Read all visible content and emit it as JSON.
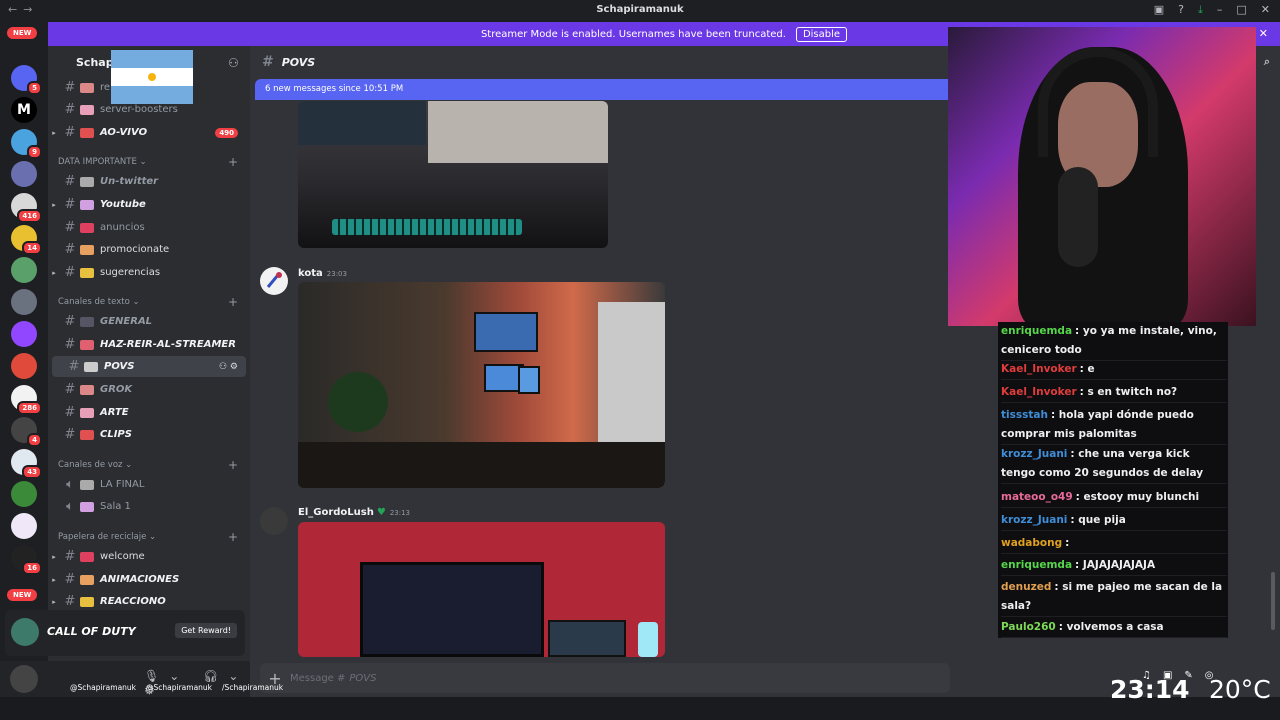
{
  "window": {
    "title": "Schapiramanuk"
  },
  "banner": {
    "text": "Streamer Mode is enabled. Usernames have been truncated.",
    "button": "Disable"
  },
  "servers": {
    "new_label": "NEW",
    "badges": [
      "5",
      "9",
      "416",
      "14",
      "286",
      "4",
      "43",
      "16"
    ]
  },
  "guild": {
    "name": "Schapi"
  },
  "channels": {
    "top": [
      {
        "name": "re",
        "style": "muted"
      },
      {
        "name": "server-boosters",
        "style": "muted"
      },
      {
        "name": "AO-VIVO",
        "style": "bold",
        "count": "490"
      }
    ],
    "cat1": "DATA IMPORTANTE",
    "group1": [
      {
        "name": "Un-twitter",
        "style": "bold-muted"
      },
      {
        "name": "Youtube",
        "style": "bold"
      },
      {
        "name": "anuncios",
        "style": "muted"
      },
      {
        "name": "promocionate",
        "style": "normal"
      },
      {
        "name": "sugerencias",
        "style": "normal"
      }
    ],
    "cat2": "Canales de texto",
    "group2": [
      {
        "name": "GENERAL",
        "style": "bold-muted"
      },
      {
        "name": "HAZ-REIR-AL-STREAMER",
        "style": "bold"
      },
      {
        "name": "POVS",
        "style": "bold"
      },
      {
        "name": "GROK",
        "style": "bold-muted"
      },
      {
        "name": "ARTE",
        "style": "bold"
      },
      {
        "name": "CLIPS",
        "style": "bold"
      }
    ],
    "cat3": "Canales de voz",
    "voice": [
      {
        "name": "LA FINAL"
      },
      {
        "name": "Sala 1"
      }
    ],
    "cat4": "Papelera de reciclaje",
    "group4": [
      {
        "name": "welcome",
        "style": "normal"
      },
      {
        "name": "ANIMACIONES",
        "style": "bold"
      },
      {
        "name": "REACCIONO",
        "style": "bold"
      }
    ]
  },
  "ad": {
    "brand": "CALL OF DUTY",
    "button": "Get Reward!"
  },
  "chat": {
    "channel": "POVS",
    "new_messages": "6 new messages since 10:51 PM",
    "messages": [
      {
        "author": "kota",
        "time": "23:03"
      },
      {
        "author": "El_GordoLush",
        "time": "23:13"
      }
    ],
    "composer_placeholder": "Message #",
    "composer_channel": "POVS"
  },
  "overlay": {
    "socials": [
      "@Schapiramanuk",
      "@Schapiramanuk",
      "/Schapiramanuk"
    ],
    "clock": "23:14",
    "temp": "20°C"
  },
  "stream_chat": [
    {
      "user": "enriquemda",
      "color": "#57d64c",
      "text": ": yo ya me instale, vino, cenicero todo"
    },
    {
      "user": "Kael_Invoker",
      "color": "#e03c3c",
      "text": ": e"
    },
    {
      "user": "Kael_Invoker",
      "color": "#e03c3c",
      "text": ": s en twitch no?"
    },
    {
      "user": "tissstah",
      "color": "#3f8ed8",
      "text": ": hola yapi dónde puedo comprar mis palomitas"
    },
    {
      "user": "krozz_Juani",
      "color": "#3f8ed8",
      "text": ": che una verga kick tengo como 20 segundos de delay"
    },
    {
      "user": "mateoo_o49",
      "color": "#e86a9a",
      "text": ": estooy muy blunchi"
    },
    {
      "user": "krozz_Juani",
      "color": "#3f8ed8",
      "text": ": que pija"
    },
    {
      "user": "wadabong",
      "color": "#e0a020",
      "text": ":"
    },
    {
      "user": "enriquemda",
      "color": "#57d64c",
      "text": ": JAJAJAJAJAJA"
    },
    {
      "user": "denuzed",
      "color": "#e0a050",
      "text": ": si me pajeo me sacan de la sala?"
    },
    {
      "user": "Paulo260",
      "color": "#7ed957",
      "text": ": volvemos a casa"
    }
  ]
}
